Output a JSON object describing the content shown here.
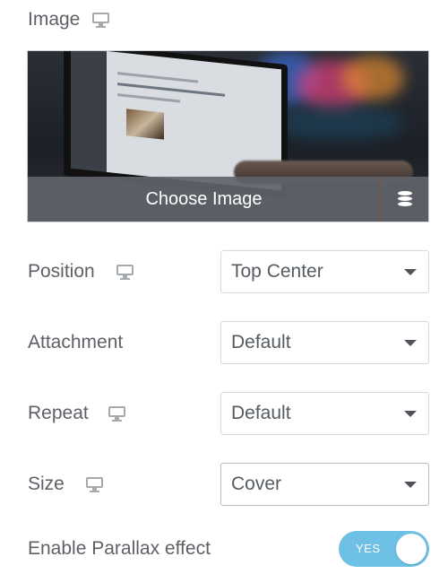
{
  "image_control": {
    "label": "Image",
    "responsive_icon": "desktop-icon",
    "choose_label": "Choose Image",
    "library_icon": "database-icon"
  },
  "fields": [
    {
      "label": "Position",
      "responsive_icon": "desktop-icon",
      "value": "Top Center"
    },
    {
      "label": "Attachment",
      "value": "Default"
    },
    {
      "label": "Repeat",
      "responsive_icon": "desktop-icon",
      "value": "Default"
    },
    {
      "label": "Size",
      "responsive_icon": "desktop-icon",
      "value": "Cover"
    }
  ],
  "parallax": {
    "label": "Enable Parallax effect",
    "toggle_text": "YES",
    "enabled": true
  },
  "colors": {
    "toggle_on": "#6ec1e4",
    "label_text": "#5d6166"
  }
}
